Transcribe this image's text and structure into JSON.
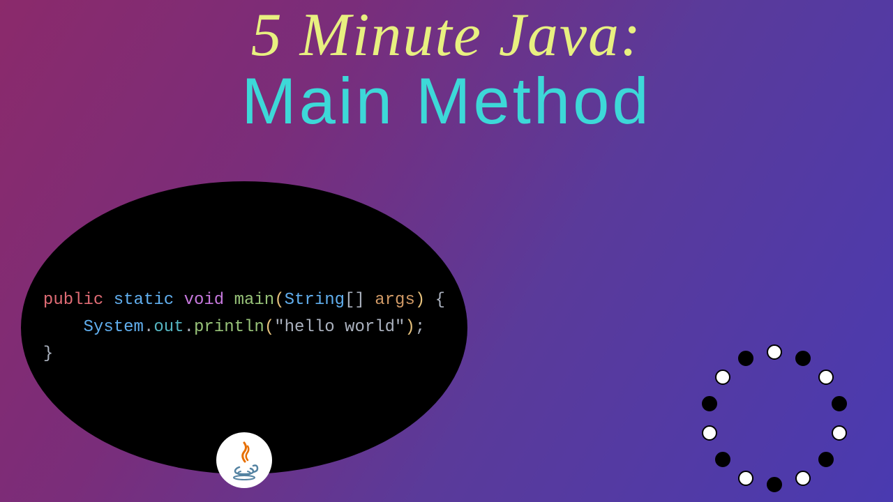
{
  "title": {
    "line1": "5 Minute Java:",
    "line2": "Main Method"
  },
  "code": {
    "tokens": [
      {
        "text": "public",
        "cls": "kw-red"
      },
      {
        "text": " ",
        "cls": "kw-white"
      },
      {
        "text": "static",
        "cls": "kw-blue"
      },
      {
        "text": " ",
        "cls": "kw-white"
      },
      {
        "text": "void",
        "cls": "kw-purple"
      },
      {
        "text": " ",
        "cls": "kw-white"
      },
      {
        "text": "main",
        "cls": "kw-green"
      },
      {
        "text": "(",
        "cls": "kw-yellow"
      },
      {
        "text": "String",
        "cls": "kw-blue"
      },
      {
        "text": "[] ",
        "cls": "kw-white"
      },
      {
        "text": "args",
        "cls": "kw-orange"
      },
      {
        "text": ")",
        "cls": "kw-yellow"
      },
      {
        "text": " {",
        "cls": "kw-white"
      },
      {
        "text": "\n    ",
        "cls": "kw-white"
      },
      {
        "text": "System",
        "cls": "kw-blue"
      },
      {
        "text": ".",
        "cls": "kw-white"
      },
      {
        "text": "out",
        "cls": "kw-cyan"
      },
      {
        "text": ".",
        "cls": "kw-white"
      },
      {
        "text": "println",
        "cls": "kw-green"
      },
      {
        "text": "(",
        "cls": "kw-yellow"
      },
      {
        "text": "\"hello world\"",
        "cls": "kw-white"
      },
      {
        "text": ")",
        "cls": "kw-yellow"
      },
      {
        "text": ";",
        "cls": "kw-white"
      },
      {
        "text": "\n}",
        "cls": "kw-white"
      }
    ]
  },
  "logo": {
    "name": "java"
  },
  "decoration": {
    "dot_count": 14
  }
}
